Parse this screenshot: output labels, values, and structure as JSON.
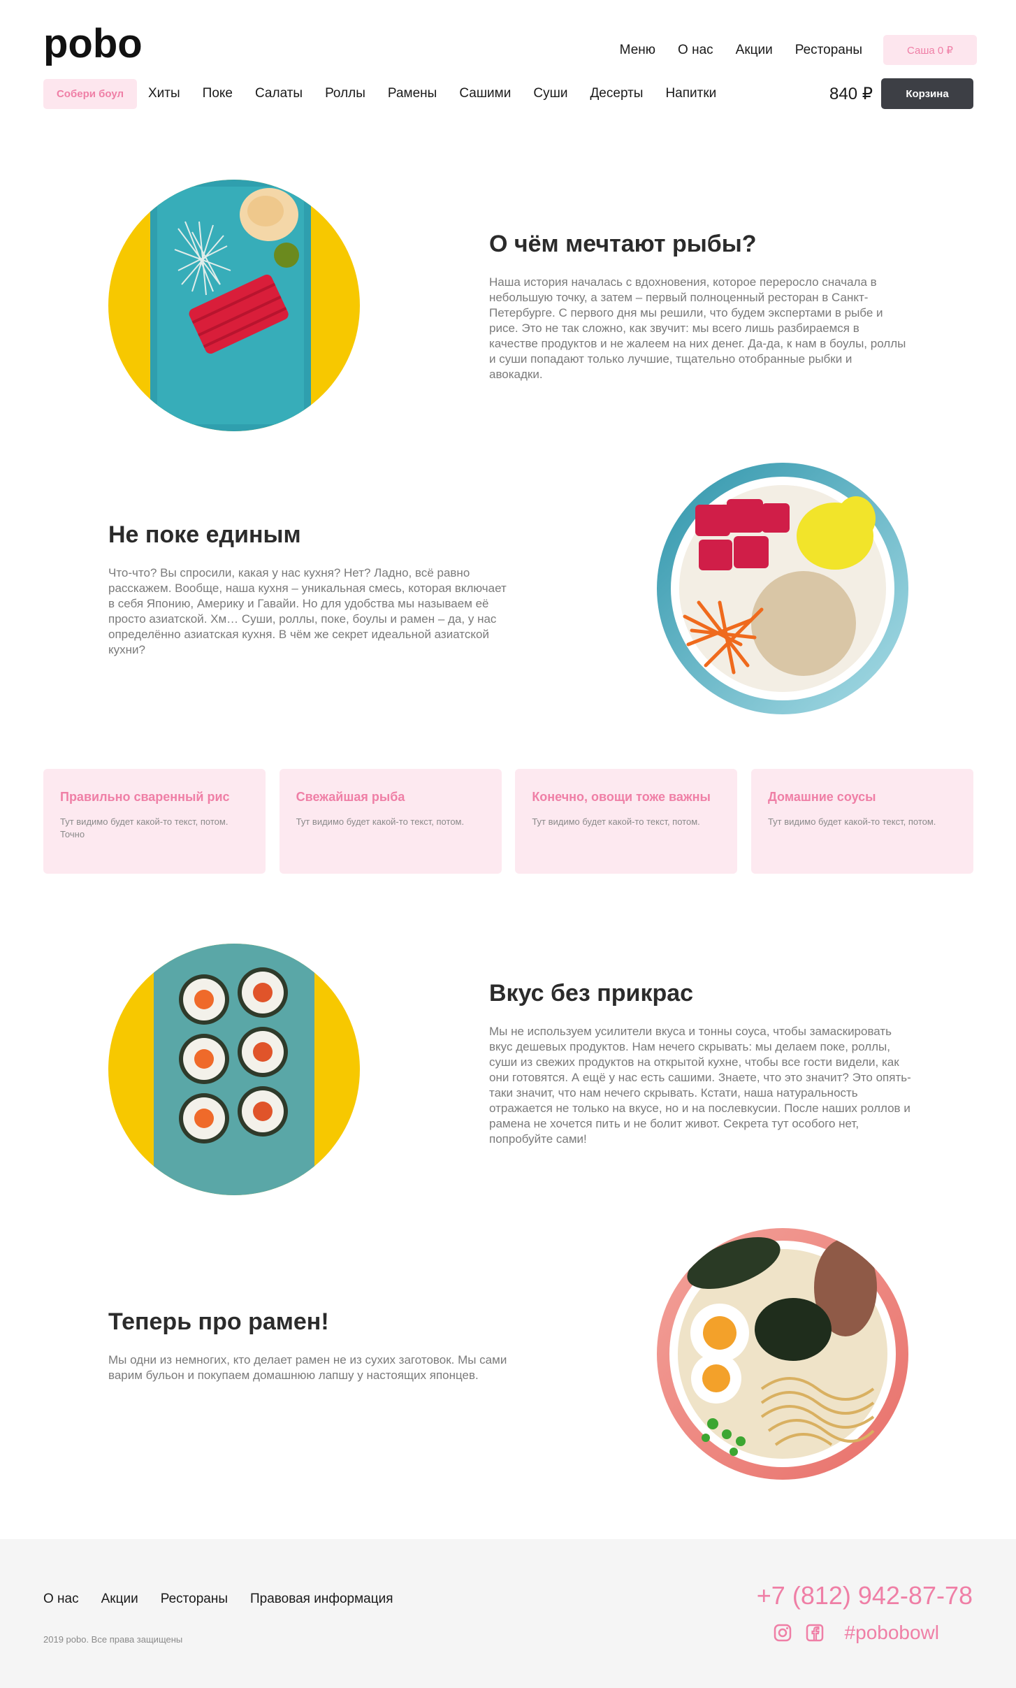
{
  "brand": {
    "logo_text": "pobo"
  },
  "top_nav": {
    "links": [
      "Меню",
      "О нас",
      "Акции",
      "Рестораны"
    ],
    "user_button": "Саша 0 ₽"
  },
  "category_nav": {
    "highlight": "Собери боул",
    "items": [
      "Хиты",
      "Поке",
      "Салаты",
      "Роллы",
      "Рамены",
      "Сашими",
      "Суши",
      "Десерты",
      "Напитки"
    ]
  },
  "cart": {
    "total": "840 ₽",
    "button": "Корзина"
  },
  "sections": [
    {
      "title": "О чём мечтают рыбы?",
      "text": "Наша история началась с вдохновения, которое переросло сначала в небольшую точку, а затем – первый полноценный ресторан в Санкт-Петербурге. С первого дня мы решили, что будем экспертами в рыбе и рисе. Это не так сложно, как звучит: мы всего лишь разбираемся в качестве продуктов и не жалеем на них денег. Да-да, к нам в боулы, роллы и суши попадают только лучшие, тщательно отобранные рыбки и авокадки."
    },
    {
      "title": "Не поке единым",
      "text": "Что-что? Вы спросили, какая у нас кухня? Нет? Ладно, всё равно расскажем. Вообще, наша кухня – уникальная смесь, которая включает в себя Японию, Америку и Гавайи. Но для удобства мы называем её просто азиатской. Хм… Суши, роллы, поке, боулы и рамен – да, у нас определённо азиатская кухня. В чём же секрет идеальной азиатской кухни?"
    },
    {
      "title": "Вкус без прикрас",
      "text": "Мы не используем усилители вкуса и тонны соуса, чтобы замаскировать вкус дешевых продуктов. Нам нечего скрывать: мы делаем поке, роллы, суши из свежих продуктов на открытой кухне, чтобы все гости видели, как они готовятся. А ещё у нас есть сашими. Знаете, что это значит? Это опять-таки значит, что нам нечего скрывать. Кстати, наша натуральность отражается не только на вкусе, но и на послевкусии. После наших роллов и рамена не хочется пить и не болит живот. Секрета тут особого нет, попробуйте сами!"
    },
    {
      "title": "Теперь про рамен!",
      "text": "Мы одни из немногих, кто делает рамен не из сухих заготовок. Мы сами варим бульон и покупаем домашнюю лапшу у настоящих японцев."
    }
  ],
  "features": [
    {
      "title": "Правильно сваренный рис",
      "text": "Тут видимо будет какой-то текст, потом. Точно"
    },
    {
      "title": "Свежайшая рыба",
      "text": "Тут видимо будет какой-то текст, потом."
    },
    {
      "title": "Конечно, овощи тоже важны",
      "text": "Тут видимо будет какой-то текст, потом."
    },
    {
      "title": "Домашние соусы",
      "text": "Тут видимо будет какой-то текст, потом."
    }
  ],
  "footer": {
    "links": [
      "О нас",
      "Акции",
      "Рестораны",
      "Правовая информация"
    ],
    "copyright": "2019 pobo. Все права защищены",
    "phone": "+7 (812) 942-87-78",
    "hashtag": "#pobobowl",
    "social_icons": [
      "instagram-icon",
      "facebook-icon"
    ]
  },
  "colors": {
    "accent_pink": "#ef7fa6",
    "pill_bg": "#fde6ee",
    "dark_button": "#3d3f45",
    "yellow": "#f7c800",
    "teal": "#3a9ab0",
    "coral": "#ef8a84"
  }
}
